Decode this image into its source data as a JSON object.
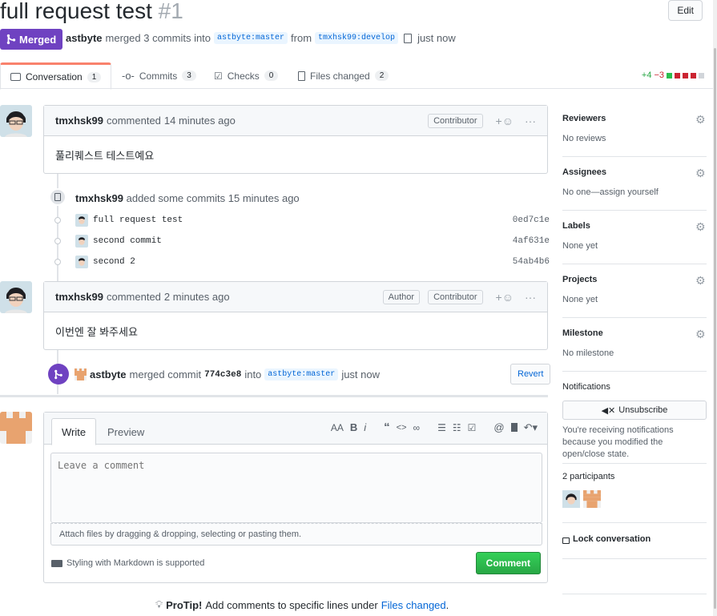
{
  "pr": {
    "title": "full request test",
    "number": "#1",
    "edit_label": "Edit",
    "state": "Merged",
    "author": "astbyte",
    "merge_text": "merged 3 commits into",
    "base_branch": "astbyte:master",
    "from_text": "from",
    "head_branch": "tmxhsk99:develop",
    "time": "just now"
  },
  "tabs": [
    {
      "label": "Conversation",
      "count": "1"
    },
    {
      "label": "Commits",
      "count": "3"
    },
    {
      "label": "Checks",
      "count": "0"
    },
    {
      "label": "Files changed",
      "count": "2"
    }
  ],
  "diffstat": {
    "additions": "+4",
    "deletions": "−3"
  },
  "comment1": {
    "author": "tmxhsk99",
    "action": "commented",
    "time": "14 minutes ago",
    "role": "Contributor",
    "body": "풀리퀘스트 테스트예요"
  },
  "commits_event": {
    "author": "tmxhsk99",
    "text": "added some commits 15 minutes ago",
    "commits": [
      {
        "message": "full request test",
        "sha": "0ed7c1e"
      },
      {
        "message": "second commit",
        "sha": "4af631e"
      },
      {
        "message": "second 2",
        "sha": "54ab4b6"
      }
    ]
  },
  "comment2": {
    "author": "tmxhsk99",
    "action": "commented",
    "time": "2 minutes ago",
    "role1": "Author",
    "role2": "Contributor",
    "body": "이번엔 잘 봐주세요"
  },
  "merge_event": {
    "author": "astbyte",
    "text": "merged commit",
    "sha": "774c3e8",
    "into": "into",
    "branch": "astbyte:master",
    "time": "just now",
    "revert_label": "Revert"
  },
  "editor": {
    "write_tab": "Write",
    "preview_tab": "Preview",
    "placeholder": "Leave a comment",
    "attach_text": "Attach files by dragging & dropping, selecting or pasting them.",
    "markdown_note": "Styling with Markdown is supported",
    "comment_button": "Comment"
  },
  "protip": {
    "label": "ProTip!",
    "text": "Add comments to specific lines under",
    "link": "Files changed",
    "period": "."
  },
  "sidebar": {
    "reviewers": {
      "title": "Reviewers",
      "value": "No reviews"
    },
    "assignees": {
      "title": "Assignees",
      "value": "No one—assign yourself"
    },
    "labels": {
      "title": "Labels",
      "value": "None yet"
    },
    "projects": {
      "title": "Projects",
      "value": "None yet"
    },
    "milestone": {
      "title": "Milestone",
      "value": "No milestone"
    },
    "notifications": {
      "title": "Notifications",
      "button": "Unsubscribe",
      "note": "You're receiving notifications because you modified the open/close state."
    },
    "participants": {
      "title": "2 participants"
    },
    "lock": "Lock conversation"
  },
  "colors": {
    "merged": "#6f42c1",
    "accent_tab": "#f9826c",
    "link": "#0366d6",
    "comment_button": "#28a745"
  }
}
